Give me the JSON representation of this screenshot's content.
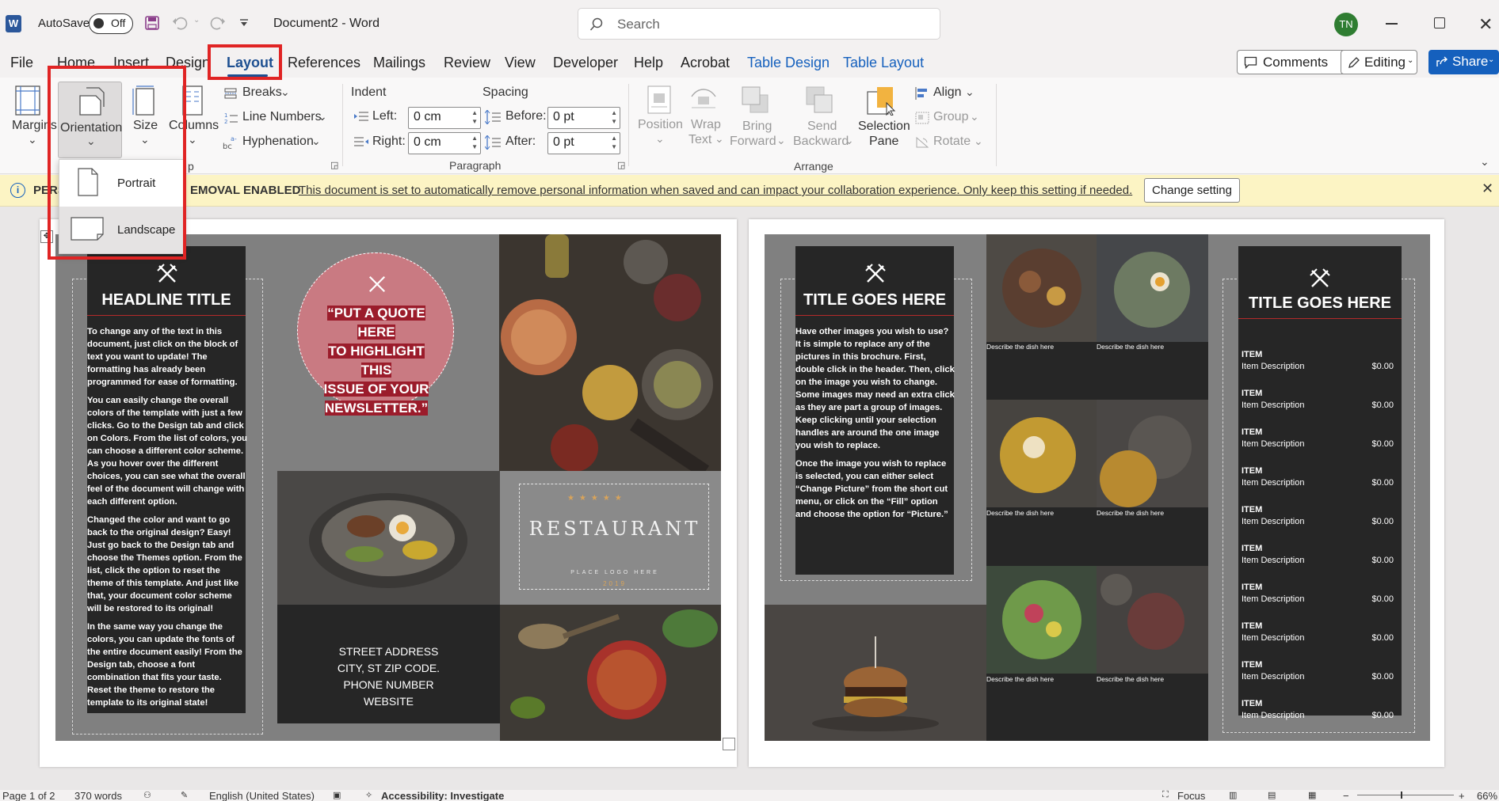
{
  "titlebar": {
    "autosave_label": "AutoSave",
    "autosave_state": "Off",
    "document_title": "Document2 - Word",
    "search_placeholder": "Search",
    "user_initials": "TN"
  },
  "tabs": [
    "File",
    "Home",
    "Insert",
    "Design",
    "Layout",
    "References",
    "Mailings",
    "Review",
    "View",
    "Developer",
    "Help",
    "Acrobat",
    "Table Design",
    "Table Layout"
  ],
  "active_tab": "Layout",
  "right_actions": {
    "comments": "Comments",
    "editing": "Editing",
    "share": "Share"
  },
  "ribbon": {
    "page_setup": {
      "margins": "Margins",
      "orientation": "Orientation",
      "size": "Size",
      "columns": "Columns",
      "breaks": "Breaks",
      "line_numbers": "Line Numbers",
      "hyphenation": "Hyphenation",
      "group_label_tail": "p"
    },
    "paragraph": {
      "indent_label": "Indent",
      "spacing_label": "Spacing",
      "left_label": "Left:",
      "right_label": "Right:",
      "before_label": "Before:",
      "after_label": "After:",
      "left_value": "0 cm",
      "right_value": "0 cm",
      "before_value": "0 pt",
      "after_value": "0 pt",
      "group_label": "Paragraph"
    },
    "arrange": {
      "position": "Position",
      "wrap_text_1": "Wrap",
      "wrap_text_2": "Text",
      "bring_forward_1": "Bring",
      "bring_forward_2": "Forward",
      "send_backward_1": "Send",
      "send_backward_2": "Backward",
      "selection_pane_1": "Selection",
      "selection_pane_2": "Pane",
      "align": "Align",
      "group": "Group",
      "rotate": "Rotate",
      "group_label": "Arrange"
    }
  },
  "orientation_menu": {
    "portrait": "Portrait",
    "landscape": "Landscape"
  },
  "infobar": {
    "prefix": "PERS",
    "title_tail": "EMOVAL ENABLED",
    "message": "This document is set to automatically remove personal information when saved and can impact your collaboration experience. Only keep this setting if needed.",
    "button": "Change setting"
  },
  "page1": {
    "headline": "HEADLINE TITLE",
    "body": [
      "To change any of the text in this document, just click on the block of text you want to update!  The formatting has already been programmed for ease of formatting.",
      "You can easily change the overall colors of the template with just a few clicks.  Go to the Design tab and click on Colors.  From the list of colors, you can choose a different color scheme.  As you hover over the different choices, you can see what the overall feel of the document will change with each different option.",
      "Changed the color and want to go back to the original design?  Easy!  Just go back to the Design tab and choose the Themes option.  From the list, click the option to reset the theme of this template.  And just like that, your document color scheme will be restored to its original!",
      "In the same way you change the colors, you can update the fonts of the entire document easily!  From the Design tab, choose a font combination that fits your taste.  Reset the theme to restore the template to its original state!"
    ],
    "quote_lines": [
      "“PUT A QUOTE HERE",
      "TO HIGHLIGHT THIS",
      "ISSUE OF YOUR",
      "NEWSLETTER.”"
    ],
    "logo_text": "RESTAURANT",
    "logo_sub": "PLACE LOGO HERE",
    "logo_year": "2019",
    "address_lines": [
      "STREET ADDRESS",
      "CITY, ST ZIP CODE.",
      "PHONE NUMBER",
      "WEBSITE"
    ]
  },
  "page2": {
    "left_title": "TITLE GOES HERE",
    "left_body": [
      "Have other images you wish to use?  It is simple to replace any of the pictures in this brochure.  First, double click in the header.  Then, click on the image you wish to change.  Some images may need an extra click as they are part a group of images.  Keep clicking until your selection handles are around the one image you wish to replace.",
      "Once the image you wish to replace is selected, you can either select “Change Picture” from the short cut menu, or click on the “Fill” option and choose the option for “Picture.”"
    ],
    "dish_caption": "Describe the dish here",
    "right_title": "TITLE GOES HERE",
    "menu_items": [
      {
        "name": "ITEM",
        "desc": "Item Description",
        "price": "$0.00"
      },
      {
        "name": "ITEM",
        "desc": "Item Description",
        "price": "$0.00"
      },
      {
        "name": "ITEM",
        "desc": "Item Description",
        "price": "$0.00"
      },
      {
        "name": "ITEM",
        "desc": "Item Description",
        "price": "$0.00"
      },
      {
        "name": "ITEM",
        "desc": "Item Description",
        "price": "$0.00"
      },
      {
        "name": "ITEM",
        "desc": "Item Description",
        "price": "$0.00"
      },
      {
        "name": "ITEM",
        "desc": "Item Description",
        "price": "$0.00"
      },
      {
        "name": "ITEM",
        "desc": "Item Description",
        "price": "$0.00"
      },
      {
        "name": "ITEM",
        "desc": "Item Description",
        "price": "$0.00"
      },
      {
        "name": "ITEM",
        "desc": "Item Description",
        "price": "$0.00"
      }
    ]
  },
  "status": {
    "page": "Page 1 of 2",
    "words": "370 words",
    "language": "English (United States)",
    "accessibility": "Accessibility: Investigate",
    "focus": "Focus",
    "zoom": "66%"
  },
  "colors": {
    "accent": "#2b579a",
    "highlight_box": "#e02424",
    "table_tab": "#1560bd",
    "quote_circle": "#c97a82"
  }
}
